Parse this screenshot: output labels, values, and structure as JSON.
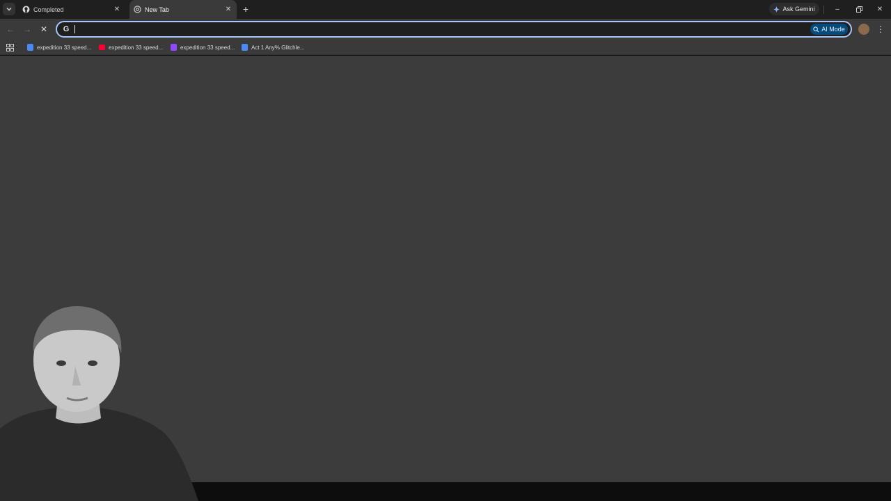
{
  "tabs": [
    {
      "title": "Completed",
      "icon": "github-icon",
      "active": false
    },
    {
      "title": "New Tab",
      "icon": "chrome-icon",
      "active": true
    }
  ],
  "tabstrip": {
    "ask_gemini_label": "Ask Gemini"
  },
  "omnibox": {
    "value": "",
    "ai_mode_label": "AI Mode"
  },
  "bookmarks": [
    {
      "label": "expedition 33 speed...",
      "icon": "google-docs-icon",
      "color": "#4a8af4"
    },
    {
      "label": "expedition 33 speed...",
      "icon": "youtube-icon",
      "color": "#ff0033"
    },
    {
      "label": "expedition 33 speed...",
      "icon": "twitch-icon",
      "color": "#9146ff"
    },
    {
      "label": "Act 1 Any% Glitchle...",
      "icon": "google-docs-icon",
      "color": "#4a8af4"
    }
  ],
  "colors": {
    "accent": "#a8c7fa",
    "ai_mode_bg": "#064b7a",
    "content_bg": "#3c3c3c"
  }
}
